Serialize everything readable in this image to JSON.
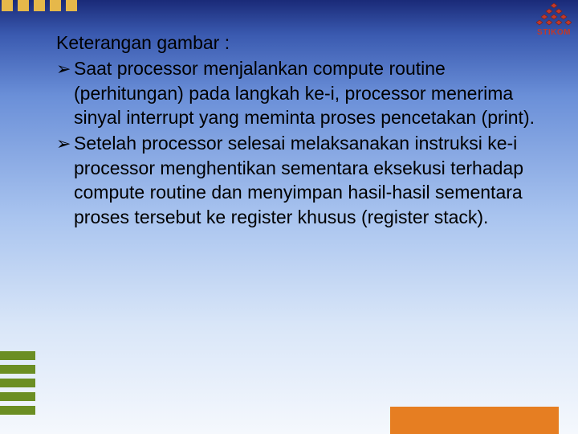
{
  "logo": {
    "label": "STIKOM"
  },
  "heading": "Keterangan gambar :",
  "bullets": [
    {
      "marker": "➢",
      "text": "Saat processor menjalankan compute routine (perhitungan) pada langkah ke-i, processor menerima sinyal interrupt yang meminta proses pencetakan (print)."
    },
    {
      "marker": "➢",
      "text": "Setelah processor selesai melaksanakan instruksi ke-i processor menghentikan sementara eksekusi terhadap compute routine dan menyimpan hasil-hasil sementara proses tersebut ke register khusus (register stack)."
    }
  ]
}
